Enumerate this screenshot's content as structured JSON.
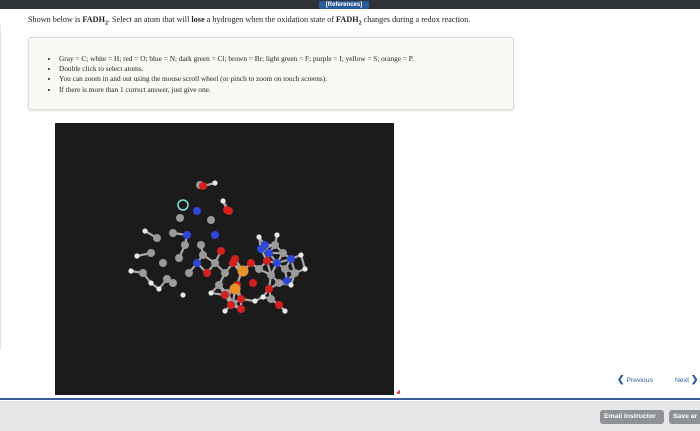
{
  "header": {
    "references_label": "[References]"
  },
  "question": {
    "pre": "Shown below is ",
    "compound": "FADH",
    "compound_sub": "2",
    "mid1": ". Select an atom that will ",
    "lose": "lose",
    "mid2": " a hydrogen when the oxidation state of ",
    "compound2": "FADH",
    "compound2_sub": "2",
    "post": " changes during a redox reaction."
  },
  "instructions": [
    "Gray = C; white = H; red = O; blue = N; dark green = Cl; brown = Br; light green = F; purple = I; yellow = S; orange = P.",
    "Double click to select atoms.",
    "You can zoom in and out using the mouse scroll wheel (or pinch to zoom on touch screens).",
    "If there is more than 1 correct answer, just give one."
  ],
  "colors": {
    "carbon": "#9a9a9a",
    "hydrogen": "#e8e8e8",
    "oxygen": "#d42020",
    "nitrogen": "#2f48d8",
    "phosphorus": "#e8902a",
    "viewer_bg": "#1b1b1b",
    "accent": "#2c58a0"
  },
  "nav": {
    "previous_label": "Previous",
    "next_label": "Next"
  },
  "footer": {
    "email_label": "Email Instructor",
    "save_label": "Save ar"
  }
}
